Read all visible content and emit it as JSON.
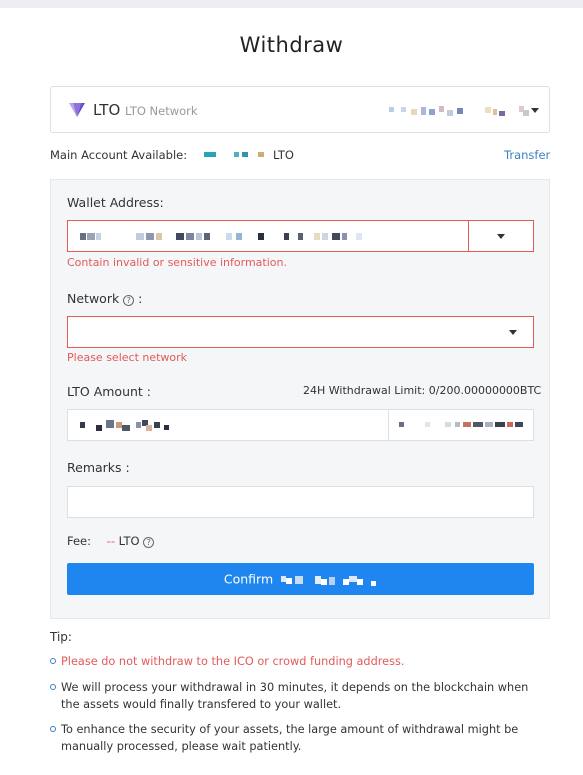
{
  "page": {
    "title": "Withdraw"
  },
  "coin_selector": {
    "symbol": "LTO",
    "network_name": "LTO Network"
  },
  "balance": {
    "label": "Main Account Available:",
    "unit": "LTO",
    "transfer_link": "Transfer"
  },
  "form": {
    "wallet_label": "Wallet Address:",
    "wallet_error": "Contain invalid or sensitive information.",
    "network_label": "Network",
    "network_colon": ":",
    "network_error": "Please select network",
    "amount_label": "LTO Amount :",
    "withdraw_limit": "24H Withdrawal Limit: 0/200.00000000BTC",
    "remarks_label": "Remarks :",
    "remarks_value": "",
    "fee_label": "Fee:",
    "fee_value": "--",
    "fee_unit": "LTO",
    "confirm_label": "Confirm"
  },
  "tips": {
    "title": "Tip:",
    "items": [
      "Please do not withdraw to the ICO or crowd funding address.",
      "We will process your withdrawal in 30 minutes, it depends on the blockchain when the assets would finally transfered to your wallet.",
      "To enhance the security of your assets, the large amount of withdrawal might be manually processed, please wait patiently."
    ]
  },
  "colors": {
    "accent": "#1f86f0",
    "error": "#e25a5a",
    "link": "#3b82c4",
    "panel_bg": "#f4f6f8"
  },
  "icons": {
    "coin": "lto-logo-icon",
    "dropdown": "chevron-down-icon",
    "help": "question-circle-icon",
    "bullet": "circle-bullet-icon"
  }
}
